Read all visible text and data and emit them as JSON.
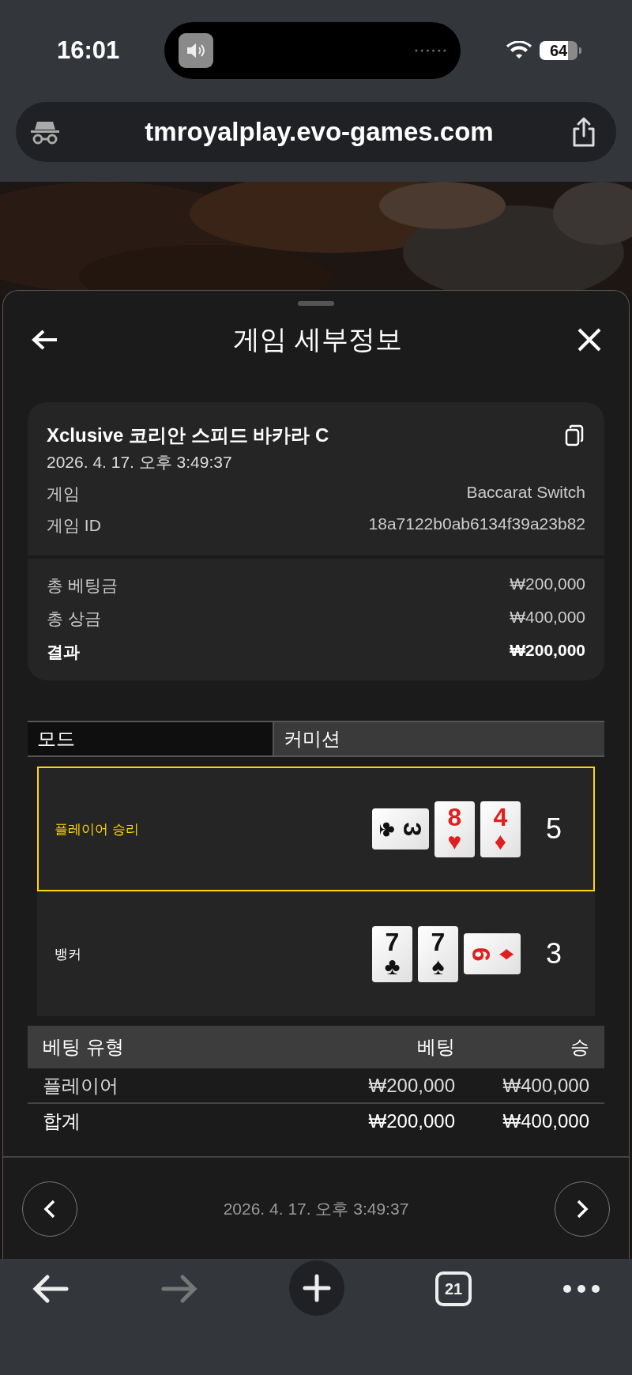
{
  "status_bar": {
    "time": "16:01",
    "battery": "64"
  },
  "address_bar": {
    "url": "tmroyalplay.evo-games.com"
  },
  "sheet": {
    "title": "게임 세부정보",
    "summary": {
      "title": "Xclusive 코리안 스피드 바카라 C",
      "date": "2026. 4. 17. 오후 3:49:37",
      "details": [
        {
          "label": "게임",
          "value": "Baccarat Switch"
        },
        {
          "label": "게임 ID",
          "value": "18a7122b0ab6134f39a23b82"
        }
      ],
      "totals": [
        {
          "label": "총 베팅금",
          "value": "₩200,000",
          "bold": false
        },
        {
          "label": "총 상금",
          "value": "₩400,000",
          "bold": false
        },
        {
          "label": "결과",
          "value": "₩200,000",
          "bold": true
        }
      ]
    },
    "mode": {
      "label": "모드",
      "value": "커미션"
    },
    "hands": [
      {
        "label": "플레이어 승리",
        "winner": true,
        "score": "5",
        "cards": [
          {
            "rank": "3",
            "suit": "♣",
            "color": "#111111",
            "kind": "cw"
          },
          {
            "rank": "8",
            "suit": "♥",
            "color": "#e02020",
            "kind": "upright"
          },
          {
            "rank": "4",
            "suit": "♦",
            "color": "#e02020",
            "kind": "upright"
          }
        ]
      },
      {
        "label": "뱅커",
        "winner": false,
        "score": "3",
        "cards": [
          {
            "rank": "7",
            "suit": "♣",
            "color": "#111111",
            "kind": "upright"
          },
          {
            "rank": "7",
            "suit": "♠",
            "color": "#111111",
            "kind": "upright"
          },
          {
            "rank": "9",
            "suit": "♦",
            "color": "#e02020",
            "kind": "ccw"
          }
        ]
      }
    ],
    "bets": {
      "columns": [
        "베팅 유형",
        "베팅",
        "승"
      ],
      "rows": [
        {
          "cells": [
            "플레이어",
            "₩200,000",
            "₩400,000"
          ],
          "kind": "row"
        },
        {
          "cells": [
            "합계",
            "₩200,000",
            "₩400,000"
          ],
          "kind": "total"
        }
      ]
    },
    "footer": {
      "date": "2026. 4. 17. 오후 3:49:37"
    }
  },
  "toolbar": {
    "back_disabled": false,
    "forward_disabled": true,
    "tabs_count": "21"
  }
}
